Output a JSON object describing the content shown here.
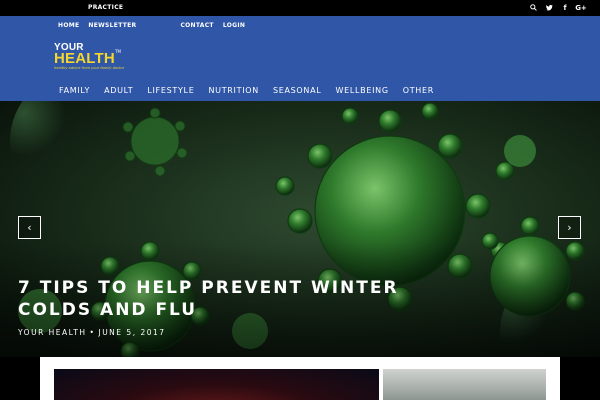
{
  "topbar": {
    "practice_label": "PRACTICE",
    "social": [
      {
        "icon": "search-icon"
      },
      {
        "icon": "twitter-icon"
      },
      {
        "icon": "facebook-icon",
        "glyph": "f"
      },
      {
        "icon": "google-plus-icon",
        "glyph": "G+"
      }
    ]
  },
  "header": {
    "bg_color": "#2f56a7",
    "nav_top": [
      "HOME",
      "NEWSLETTER",
      "CONTACT",
      "LOGIN"
    ],
    "logo": {
      "line1": "YOUR",
      "line2": "HEALTH",
      "tm": "TM",
      "tagline": "healthy advice from your family doctor"
    },
    "nav_main": [
      "FAMILY",
      "ADULT",
      "LIFESTYLE",
      "NUTRITION",
      "SEASONAL",
      "WELLBEING",
      "OTHER"
    ]
  },
  "hero": {
    "title": "7 TIPS TO HELP PREVENT WINTER COLDS AND FLU",
    "author": "YOUR HEALTH",
    "separator": "•",
    "date": "JUNE 5, 2017",
    "prev_glyph": "‹",
    "next_glyph": "›"
  }
}
